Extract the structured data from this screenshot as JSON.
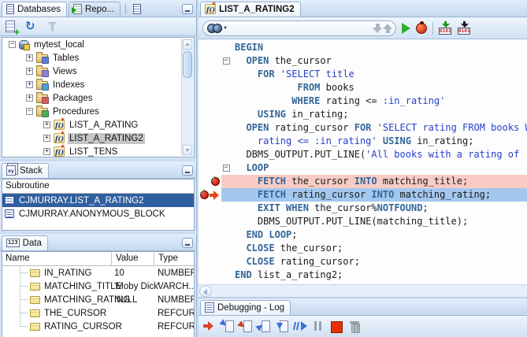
{
  "colors": {
    "selection_blue": "#2f5f9e",
    "keyword": "#336699",
    "string": "#2640cc",
    "breakpoint_line": "#f8ccc5",
    "current_execution_line": "#a3c7ee"
  },
  "left": {
    "databases_panel": {
      "tabs": [
        {
          "label": "Databases",
          "icon": "document-icon",
          "active": true
        },
        {
          "label": "Repo...",
          "icon": "report-icon",
          "active": false
        },
        {
          "label": "",
          "icon": "document-icon",
          "active": false
        }
      ],
      "toolbar": [
        {
          "name": "add-document-icon"
        },
        {
          "name": "refresh-icon"
        },
        {
          "name": "filter-icon"
        }
      ],
      "tree": [
        {
          "label": "mytest_local",
          "depth": 0,
          "expand": "minus",
          "icon": "database",
          "selected": false
        },
        {
          "label": "Tables",
          "depth": 1,
          "expand": "plus",
          "icon": "folder-tables",
          "selected": false
        },
        {
          "label": "Views",
          "depth": 1,
          "expand": "plus",
          "icon": "folder-views",
          "selected": false
        },
        {
          "label": "Indexes",
          "depth": 1,
          "expand": "plus",
          "icon": "folder-indexes",
          "selected": false
        },
        {
          "label": "Packages",
          "depth": 1,
          "expand": "plus",
          "icon": "folder-packages",
          "selected": false
        },
        {
          "label": "Procedures",
          "depth": 1,
          "expand": "minus",
          "icon": "folder-procedures",
          "selected": false
        },
        {
          "label": "LIST_A_RATING",
          "depth": 2,
          "expand": "plus",
          "icon": "procedure",
          "selected": false
        },
        {
          "label": "LIST_A_RATING2",
          "depth": 2,
          "expand": "plus",
          "icon": "procedure",
          "selected": true
        },
        {
          "label": "LIST_TENS",
          "depth": 2,
          "expand": "plus",
          "icon": "procedure",
          "selected": false
        }
      ]
    },
    "stack_panel": {
      "tab_label": "Stack",
      "column_header": "Subroutine",
      "rows": [
        {
          "label": "CJMURRAY.LIST_A_RATING2",
          "selected": true
        },
        {
          "label": "CJMURRAY.ANONYMOUS_BLOCK",
          "selected": false
        }
      ]
    },
    "data_panel": {
      "tab_label": "Data",
      "tab_icon_label": "123",
      "columns": [
        "Name",
        "Value",
        "Type"
      ],
      "rows": [
        {
          "name": "IN_RATING",
          "value": "10",
          "type": "NUMBER"
        },
        {
          "name": "MATCHING_TITLE",
          "value": "'Moby Dick'",
          "type": "VARCH..."
        },
        {
          "name": "MATCHING_RATING",
          "value": "NULL",
          "type": "NUMBER"
        },
        {
          "name": "THE_CURSOR",
          "value": "",
          "type": "REFCUR..."
        },
        {
          "name": "RATING_CURSOR",
          "value": "",
          "type": "REFCUR..."
        }
      ]
    }
  },
  "editor": {
    "tab_label": "LIST_A_RATING2",
    "toolbar": {
      "icons": [
        {
          "name": "search-binoculars-icon"
        },
        {
          "name": "find-previous-icon"
        },
        {
          "name": "find-next-icon"
        },
        {
          "name": "run-icon"
        },
        {
          "name": "debug-icon"
        },
        {
          "name": "compile-icon",
          "label": "0101"
        },
        {
          "name": "compile-for-debug-icon",
          "label": "0101"
        }
      ]
    },
    "code_lines": [
      {
        "segs": [
          [
            "kw",
            "BEGIN"
          ]
        ]
      },
      {
        "fold": true,
        "segs": [
          [
            "pl",
            "  "
          ],
          [
            "kw",
            "OPEN"
          ],
          [
            "pl",
            " the_cursor"
          ]
        ]
      },
      {
        "segs": [
          [
            "pl",
            "    "
          ],
          [
            "kw",
            "FOR"
          ],
          [
            "pl",
            " "
          ],
          [
            "str",
            "'SELECT title"
          ]
        ]
      },
      {
        "segs": [
          [
            "pl",
            "           "
          ],
          [
            "kw",
            "FROM"
          ],
          [
            "pl",
            " books"
          ]
        ]
      },
      {
        "segs": [
          [
            "pl",
            "          "
          ],
          [
            "kw",
            "WHERE"
          ],
          [
            "pl",
            " rating <= "
          ],
          [
            "str",
            ":in_rating'"
          ]
        ]
      },
      {
        "segs": [
          [
            "pl",
            "    "
          ],
          [
            "kw",
            "USING"
          ],
          [
            "pl",
            " in_rating;"
          ]
        ]
      },
      {
        "segs": [
          [
            "pl",
            "  "
          ],
          [
            "kw",
            "OPEN"
          ],
          [
            "pl",
            " rating_cursor "
          ],
          [
            "kw",
            "FOR"
          ],
          [
            "pl",
            " "
          ],
          [
            "str",
            "'SELECT rating FROM books WHERE"
          ]
        ]
      },
      {
        "segs": [
          [
            "pl",
            "    "
          ],
          [
            "str",
            "rating <= :in_rating'"
          ],
          [
            "pl",
            " "
          ],
          [
            "kw",
            "USING"
          ],
          [
            "pl",
            " in_rating;"
          ]
        ]
      },
      {
        "segs": [
          [
            "pl",
            "  DBMS_OUTPUT.PUT_LINE("
          ],
          [
            "str",
            "'All books with a rating of '"
          ]
        ]
      },
      {
        "fold": true,
        "segs": [
          [
            "pl",
            "  "
          ],
          [
            "kw",
            "LOOP"
          ]
        ]
      },
      {
        "hl": "pink",
        "bp": true,
        "segs": [
          [
            "pl",
            "    "
          ],
          [
            "kw",
            "FETCH"
          ],
          [
            "pl",
            " the_cursor "
          ],
          [
            "kw",
            "INTO"
          ],
          [
            "pl",
            " matching_title;"
          ]
        ]
      },
      {
        "hl": "blue",
        "bp": true,
        "arrow": true,
        "segs": [
          [
            "pl",
            "    "
          ],
          [
            "kw",
            "FETCH"
          ],
          [
            "pl",
            " rating_cursor "
          ],
          [
            "kw",
            "INTO"
          ],
          [
            "pl",
            " matching_rating;"
          ]
        ]
      },
      {
        "segs": [
          [
            "pl",
            "    "
          ],
          [
            "kw",
            "EXIT"
          ],
          [
            "pl",
            " "
          ],
          [
            "kw",
            "WHEN"
          ],
          [
            "pl",
            " the_cursor%"
          ],
          [
            "kw",
            "NOTFOUND"
          ],
          [
            "pl",
            ";"
          ]
        ]
      },
      {
        "segs": [
          [
            "pl",
            "    DBMS_OUTPUT.PUT_LINE(matching_title);"
          ]
        ]
      },
      {
        "segs": [
          [
            "pl",
            "  "
          ],
          [
            "kw",
            "END"
          ],
          [
            "pl",
            " "
          ],
          [
            "kw",
            "LOOP"
          ],
          [
            "pl",
            ";"
          ]
        ]
      },
      {
        "segs": [
          [
            "pl",
            "  "
          ],
          [
            "kw",
            "CLOSE"
          ],
          [
            "pl",
            " the_cursor;"
          ]
        ]
      },
      {
        "segs": [
          [
            "pl",
            "  "
          ],
          [
            "kw",
            "CLOSE"
          ],
          [
            "pl",
            " rating_cursor;"
          ]
        ]
      },
      {
        "segs": [
          [
            "kw",
            "END"
          ],
          [
            "pl",
            " list_a_rating2;"
          ]
        ]
      }
    ]
  },
  "log_panel": {
    "tab_label": "Debugging - Log",
    "toolbar": [
      {
        "name": "find-execution-point-icon"
      },
      {
        "name": "step-over-icon"
      },
      {
        "name": "step-into-icon"
      },
      {
        "name": "step-out-icon"
      },
      {
        "name": "step-to-end-icon"
      },
      {
        "name": "resume-icon"
      },
      {
        "name": "pause-icon"
      },
      {
        "name": "terminate-icon"
      },
      {
        "name": "garbage-collect-icon"
      }
    ]
  }
}
